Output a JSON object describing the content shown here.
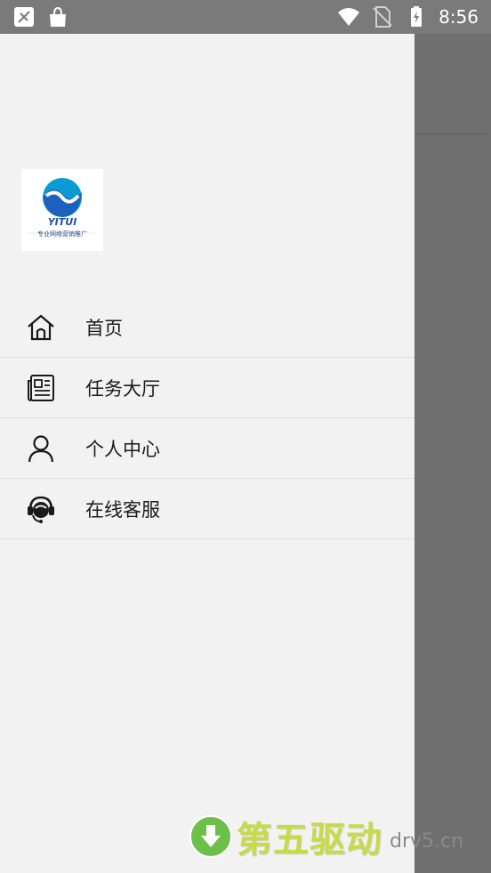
{
  "status_bar": {
    "time": "8:56",
    "icons": [
      "no-signal-icon",
      "bag-icon",
      "wifi-icon",
      "no-sim-icon",
      "battery-charging-icon"
    ]
  },
  "logo": {
    "brand": "YITUI",
    "tagline": "专业网络营销推广",
    "colors": {
      "primary": "#1f5fbf",
      "accent": "#0c9ad6"
    }
  },
  "menu": {
    "items": [
      {
        "label": "首页",
        "icon": "home-icon"
      },
      {
        "label": "任务大厅",
        "icon": "newspaper-icon"
      },
      {
        "label": "个人中心",
        "icon": "user-icon"
      },
      {
        "label": "在线客服",
        "icon": "headset-icon"
      }
    ]
  },
  "watermark": {
    "text": "第五驱动",
    "domain": "drv5.cn",
    "colors": {
      "text": "#c8d94a",
      "badge": "#6cc04a"
    }
  }
}
